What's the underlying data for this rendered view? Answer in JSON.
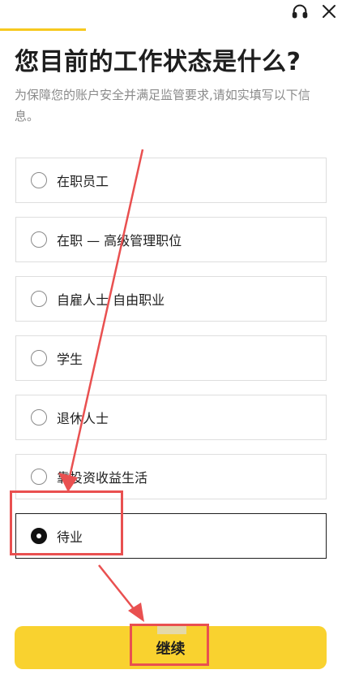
{
  "header": {
    "progress_percent": 25,
    "accent_color": "#f7c91f",
    "headset_icon": "headset-icon",
    "close_icon": "close-icon"
  },
  "question": {
    "title": "您目前的工作状态是什么?",
    "subtitle": "为保障您的账户安全并满足监管要求,请如实填写以下信息。"
  },
  "options": [
    {
      "label": "在职员工",
      "selected": false
    },
    {
      "label": "在职 — 高级管理职位",
      "selected": false
    },
    {
      "label": "自雇人士 自由职业",
      "selected": false
    },
    {
      "label": "学生",
      "selected": false
    },
    {
      "label": "退休人士",
      "selected": false
    },
    {
      "label": "靠投资收益生活",
      "selected": false
    },
    {
      "label": "待业",
      "selected": true
    }
  ],
  "footer": {
    "continue_label": "继续",
    "button_color": "#f9d22f"
  },
  "annotation_color": "#e95050"
}
